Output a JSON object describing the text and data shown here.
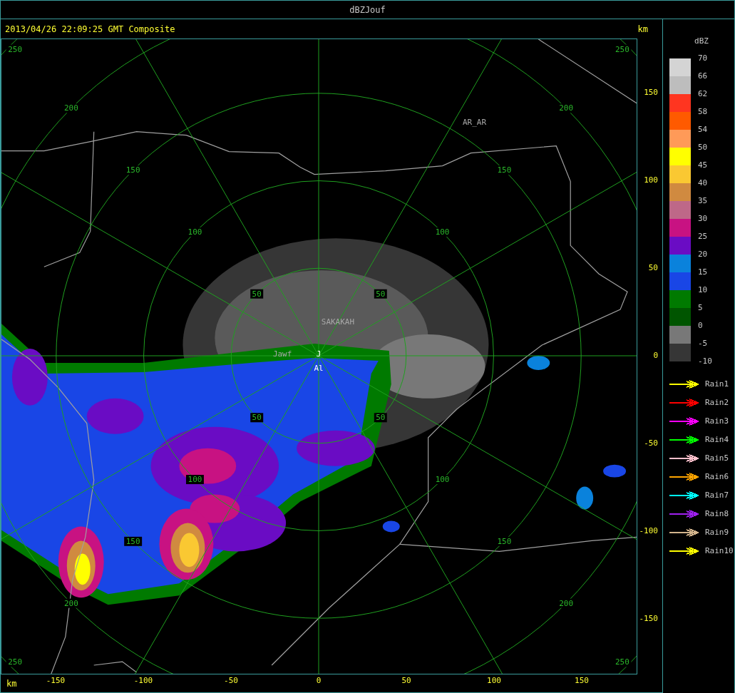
{
  "window": {
    "title": "dBZJouf"
  },
  "header": {
    "timestamp": "2013/04/26 22:09:25 GMT Composite",
    "unit": "km"
  },
  "range_rings": [
    {
      "labels": [
        "50",
        "50",
        "50",
        "50"
      ]
    },
    {
      "labels": [
        "100",
        "100",
        "100",
        "100"
      ]
    },
    {
      "labels": [
        "150",
        "150",
        "150",
        "150"
      ]
    },
    {
      "labels": [
        "200",
        "200",
        "200",
        "200"
      ]
    },
    {
      "labels": [
        "250",
        "250",
        "250",
        "250"
      ]
    }
  ],
  "places": [
    {
      "name": "AR_AR",
      "kind": "place"
    },
    {
      "name": "SAKAKAH",
      "kind": "place"
    },
    {
      "name": "Jawf",
      "kind": "place"
    },
    {
      "name": "J",
      "kind": "site"
    },
    {
      "name": "Al",
      "kind": "site"
    }
  ],
  "y_axis": {
    "ticks": [
      "150",
      "100",
      "50",
      "0",
      "-50",
      "-100",
      "-150"
    ]
  },
  "x_axis": {
    "unit": "km",
    "ticks": [
      "-150",
      "-100",
      "-50",
      "0",
      "50",
      "100",
      "150"
    ]
  },
  "legend": {
    "title": "dBZ",
    "swatches": [
      {
        "color": "#d4d4d4"
      },
      {
        "color": "#bdbdbd"
      },
      {
        "color": "#ff3520"
      },
      {
        "color": "#ff5a00"
      },
      {
        "color": "#ff9a58"
      },
      {
        "color": "#ffff00"
      },
      {
        "color": "#fac832"
      },
      {
        "color": "#d08a40"
      },
      {
        "color": "#be6888"
      },
      {
        "color": "#c81282"
      },
      {
        "color": "#6a0cc4"
      },
      {
        "color": "#0a82dc"
      },
      {
        "color": "#1946e6"
      },
      {
        "color": "#007a00"
      },
      {
        "color": "#005500"
      },
      {
        "color": "#787878"
      },
      {
        "color": "#363636"
      }
    ],
    "labels": [
      "70",
      "66",
      "62",
      "58",
      "54",
      "50",
      "45",
      "40",
      "35",
      "30",
      "25",
      "20",
      "15",
      "10",
      "5",
      "0",
      "-5",
      "-10"
    ]
  },
  "rain_tracks": [
    {
      "label": "Rain1",
      "color": "#ffff00"
    },
    {
      "label": "Rain2",
      "color": "#ff0000"
    },
    {
      "label": "Rain3",
      "color": "#ff00ff"
    },
    {
      "label": "Rain4",
      "color": "#00ff00"
    },
    {
      "label": "Rain5",
      "color": "#ffc0cb"
    },
    {
      "label": "Rain6",
      "color": "#ffa500"
    },
    {
      "label": "Rain7",
      "color": "#00ffff"
    },
    {
      "label": "Rain8",
      "color": "#a020f0"
    },
    {
      "label": "Rain9",
      "color": "#d2b48c"
    },
    {
      "label": "Rain10",
      "color": "#ffff00"
    }
  ]
}
